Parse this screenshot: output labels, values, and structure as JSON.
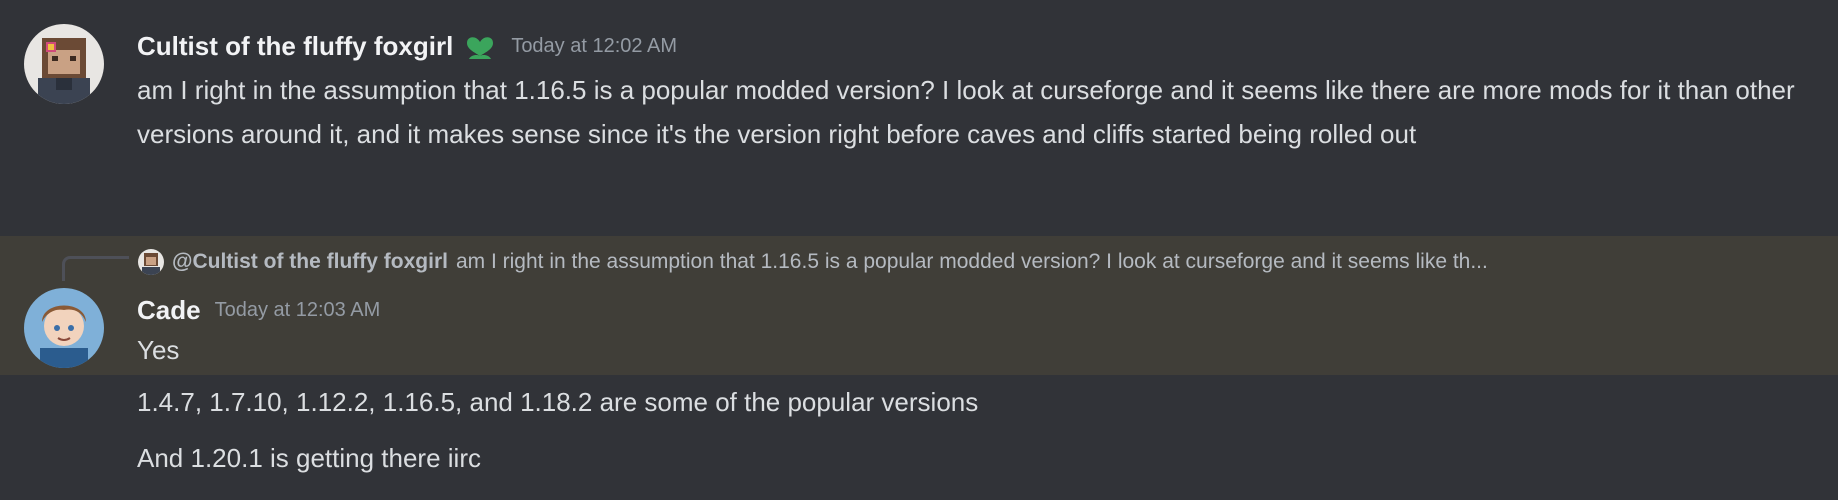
{
  "messages": [
    {
      "author": "Cultist of the fluffy foxgirl",
      "badge_icon": "heart-flower-icon",
      "badge_color": "#3ba55c",
      "timestamp": "Today at 12:02 AM",
      "content": "am I right in the assumption that 1.16.5 is a popular modded version? I look at curseforge and it seems like there are more mods for it than other versions around it, and it makes sense since it's the version right before caves and cliffs started being rolled out"
    },
    {
      "reply": {
        "author": "@Cultist of the fluffy foxgirl",
        "text": "am I right in the assumption that 1.16.5 is a popular modded version? I look at curseforge and it seems like th..."
      },
      "author": "Cade",
      "timestamp": "Today at 12:03 AM",
      "content": "Yes"
    },
    {
      "content": "1.4.7, 1.7.10, 1.12.2, 1.16.5, and 1.18.2 are some of the popular versions"
    },
    {
      "content": "And 1.20.1 is getting there iirc"
    }
  ]
}
